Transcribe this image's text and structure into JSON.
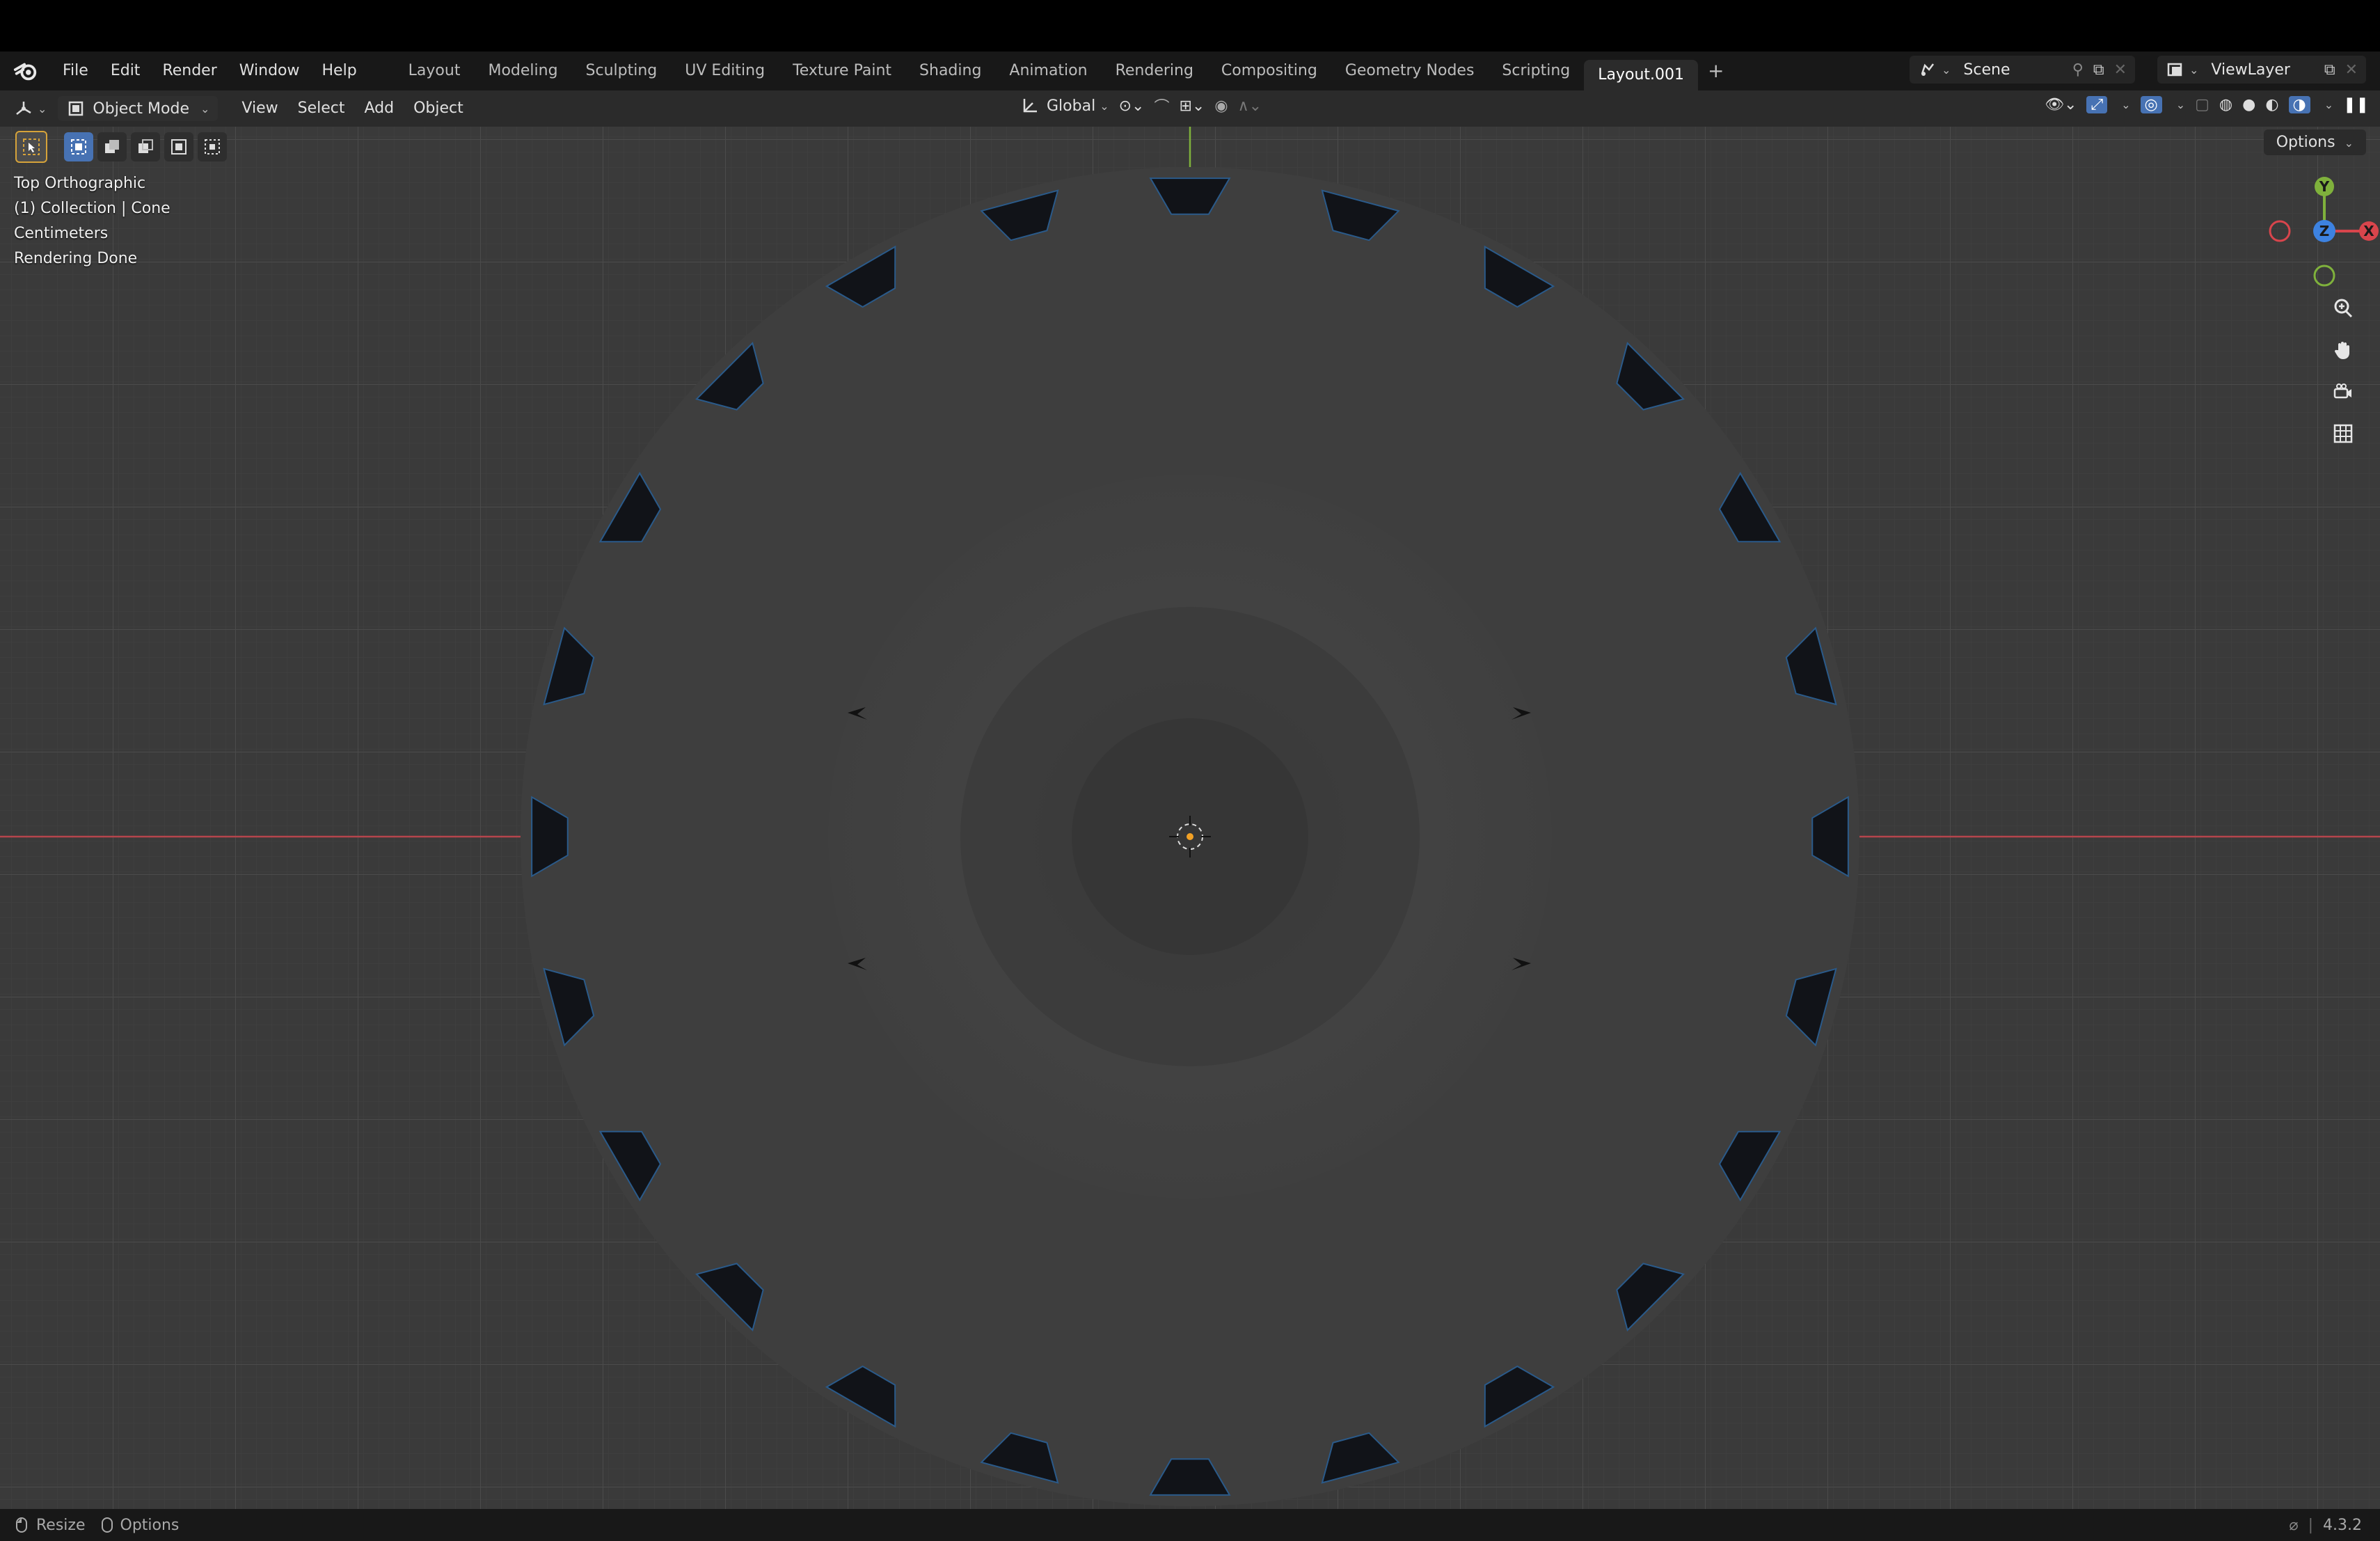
{
  "menubar": {
    "items": [
      "File",
      "Edit",
      "Render",
      "Window",
      "Help"
    ],
    "workspaces": [
      "Layout",
      "Modeling",
      "Sculpting",
      "UV Editing",
      "Texture Paint",
      "Shading",
      "Animation",
      "Rendering",
      "Compositing",
      "Geometry Nodes",
      "Scripting",
      "Layout.001"
    ],
    "active_workspace": "Layout.001",
    "add_tab": "+",
    "scene_name": "Scene",
    "view_layer": "ViewLayer"
  },
  "header": {
    "mode": "Object Mode",
    "menus": [
      "View",
      "Select",
      "Add",
      "Object"
    ],
    "orientation": "Global"
  },
  "viewport": {
    "info_lines": [
      "Top Orthographic",
      "(1) Collection | Cone",
      "Centimeters",
      "Rendering Done"
    ],
    "options_label": "Options",
    "gizmo": {
      "y": "Y",
      "z": "Z",
      "x": "X"
    }
  },
  "status": {
    "resize": "Resize",
    "options": "Options",
    "version": "4.3.2"
  },
  "colors": {
    "accent_active": "#4772b3",
    "x_axis": "#d8454c",
    "y_axis": "#7fb13c",
    "z_axis": "#3d82e0"
  }
}
